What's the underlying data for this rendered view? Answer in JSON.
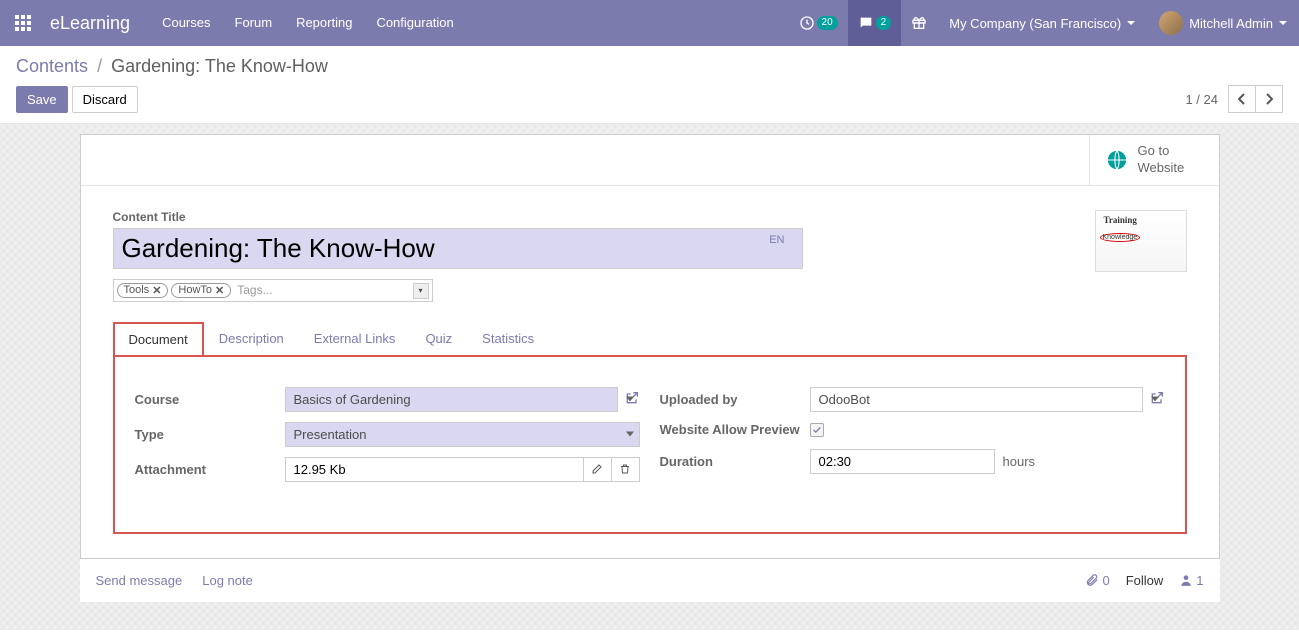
{
  "navbar": {
    "brand": "eLearning",
    "menu": [
      "Courses",
      "Forum",
      "Reporting",
      "Configuration"
    ],
    "clock_badge": "20",
    "chat_badge": "2",
    "company": "My Company (San Francisco)",
    "user": "Mitchell Admin"
  },
  "breadcrumb": {
    "parent": "Contents",
    "current": "Gardening: The Know-How"
  },
  "buttons": {
    "save": "Save",
    "discard": "Discard"
  },
  "pager": {
    "text": "1 / 24"
  },
  "stat_button": {
    "line1": "Go to",
    "line2": "Website"
  },
  "form": {
    "title_label": "Content Title",
    "title": "Gardening: The Know-How",
    "lang": "EN",
    "tags": [
      "Tools",
      "HowTo"
    ],
    "tags_placeholder": "Tags...",
    "tabs": [
      "Document",
      "Description",
      "External Links",
      "Quiz",
      "Statistics"
    ],
    "left": {
      "course_label": "Course",
      "course": "Basics of Gardening",
      "type_label": "Type",
      "type": "Presentation",
      "attachment_label": "Attachment",
      "attachment": "12.95 Kb"
    },
    "right": {
      "uploaded_label": "Uploaded by",
      "uploaded": "OdooBot",
      "preview_label": "Website Allow Preview",
      "duration_label": "Duration",
      "duration": "02:30",
      "duration_unit": "hours"
    }
  },
  "chatter": {
    "send": "Send message",
    "log": "Log note",
    "attach_count": "0",
    "follow": "Follow",
    "followers": "1"
  }
}
